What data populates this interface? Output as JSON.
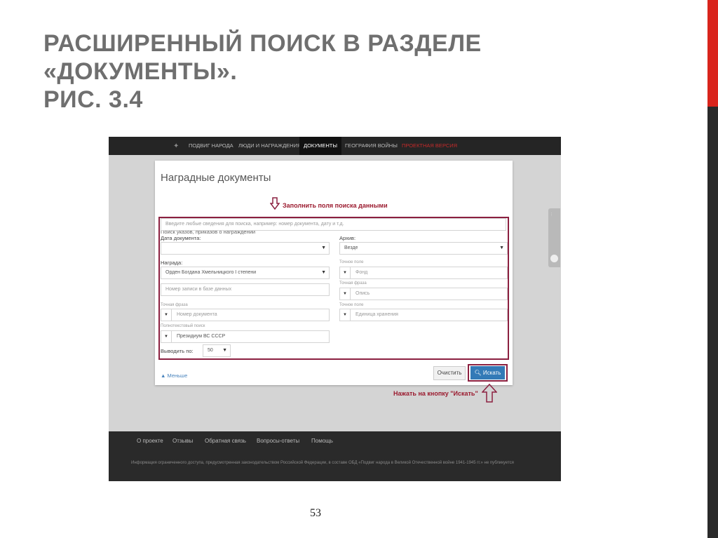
{
  "slide": {
    "title_lines": [
      "РАСШИРЕННЫЙ ПОИСК В РАЗДЕЛЕ",
      "«ДОКУМЕНТЫ».",
      "РИС. 3.4"
    ],
    "page_number": "53"
  },
  "nav": {
    "items": [
      "ПОДВИГ НАРОДА",
      "ЛЮДИ И НАГРАЖДЕНИЯ",
      "ДОКУМЕНТЫ",
      "ГЕОГРАФИЯ ВОЙНЫ",
      "ПРОЕКТНАЯ ВЕРСИЯ"
    ],
    "active_item": "ДОКУМЕНТЫ",
    "colors": {
      "bar": "#252525",
      "red_item": "#c42a2a"
    }
  },
  "form": {
    "title": "Наградные документы",
    "section_label": "Поиск указов, приказов о награждении",
    "query_placeholder": "Введите любые сведения для поиска, например: номер документа, дату и т.д.",
    "date": {
      "label": "Дата документа:",
      "value": ""
    },
    "archive": {
      "label": "Архив:",
      "value": "Везде"
    },
    "award": {
      "label": "Награда:",
      "value": "Орден Богдана Хмельницкого I степени"
    },
    "record_number": {
      "placeholder": "Номер записи в базе данных"
    },
    "exact_phrase": {
      "label": "Точная фраза",
      "placeholder": "Номер документа"
    },
    "fulltext": {
      "label": "Полнотекстовый поиск",
      "value": "Президиум ВС СССР"
    },
    "fond": {
      "label": "Точное поле",
      "placeholder": "Фонд"
    },
    "opis": {
      "label": "Точная фраза",
      "placeholder": "Опись"
    },
    "storage": {
      "label": "Точное поле",
      "placeholder": "Единица хранения"
    },
    "per_page": {
      "label": "Выводить по:",
      "value": "50"
    },
    "less_link": "▲ Меньше",
    "clear_button": "Очистить",
    "search_button": "Искать"
  },
  "annotations": {
    "fill_fields": "Заполнить поля поиска данными",
    "press_button": "Нажать на кнопку \"Искать\"",
    "color": "#8b2040"
  },
  "footer": {
    "links": [
      "О проекте",
      "Отзывы",
      "Обратная связь",
      "Вопросы-ответы",
      "Помощь"
    ],
    "note": "Информация ограниченного доступа, предусмотренная законодательством Российской Федерации, в составе ОБД «Подвиг народа в Великой Отечественной войне 1941-1945 гг.» не публикуется"
  }
}
